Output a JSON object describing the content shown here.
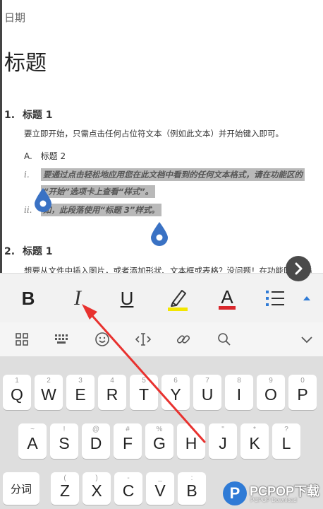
{
  "document": {
    "date_placeholder": "日期",
    "title": "标题",
    "sections": [
      {
        "number": "1.",
        "heading": "标题 1",
        "text": "要立即开始，只需点击任何占位符文本（例如此文本）并开始键入即可。"
      },
      {
        "number": "2.",
        "heading": "标题 1",
        "text": "想要从文件中插入图片，或者添加形状、文本框或表格？没问题！在功能区的“插"
      }
    ],
    "subheading": {
      "number": "A.",
      "text": "标题 2"
    },
    "selected_lines": [
      {
        "numeral": "i.",
        "text": "要通过点击轻松地应用您在此文档中看到的任何文本格式，请在功能区的"
      },
      {
        "numeral": "",
        "text": "“开始”选项卡上查看“样式”。"
      },
      {
        "numeral": "ii.",
        "text": "如，此段落使用“标题 3”样式。"
      }
    ]
  },
  "format_toolbar": {
    "bold": "B",
    "italic": "I",
    "underline": "U",
    "font_color": "A",
    "highlight_color": "#f3e600",
    "font_color_value": "#d9262b"
  },
  "keyboard_tools": [
    {
      "icon": "grid-icon"
    },
    {
      "icon": "keyboard-icon"
    },
    {
      "icon": "emoji-icon"
    },
    {
      "icon": "cursor-move-icon"
    },
    {
      "icon": "link-icon"
    },
    {
      "icon": "search-icon"
    },
    {
      "icon": "chevron-down-icon"
    }
  ],
  "keyboard": {
    "row1": [
      {
        "key": "Q",
        "sub": "1"
      },
      {
        "key": "W",
        "sub": "2"
      },
      {
        "key": "E",
        "sub": "3"
      },
      {
        "key": "R",
        "sub": "4"
      },
      {
        "key": "T",
        "sub": "5"
      },
      {
        "key": "Y",
        "sub": "6"
      },
      {
        "key": "U",
        "sub": "7"
      },
      {
        "key": "I",
        "sub": "8"
      },
      {
        "key": "O",
        "sub": "9"
      },
      {
        "key": "P",
        "sub": "0"
      }
    ],
    "row2": [
      {
        "key": "A",
        "sub": "~"
      },
      {
        "key": "S",
        "sub": "!"
      },
      {
        "key": "D",
        "sub": "@"
      },
      {
        "key": "F",
        "sub": "#"
      },
      {
        "key": "G",
        "sub": "%"
      },
      {
        "key": "H",
        "sub": "\""
      },
      {
        "key": "J",
        "sub": "\""
      },
      {
        "key": "K",
        "sub": "*"
      },
      {
        "key": "L",
        "sub": "?"
      }
    ],
    "row3": [
      {
        "key": "Z",
        "sub": "("
      },
      {
        "key": "X",
        "sub": ")"
      },
      {
        "key": "C",
        "sub": "-"
      },
      {
        "key": "V",
        "sub": "_"
      },
      {
        "key": "B",
        "sub": ":"
      }
    ],
    "fn_label": "分词"
  },
  "watermark": {
    "logo_letter": "P",
    "name": "PCPOP下载",
    "subtitle": "PCPOP Download"
  }
}
